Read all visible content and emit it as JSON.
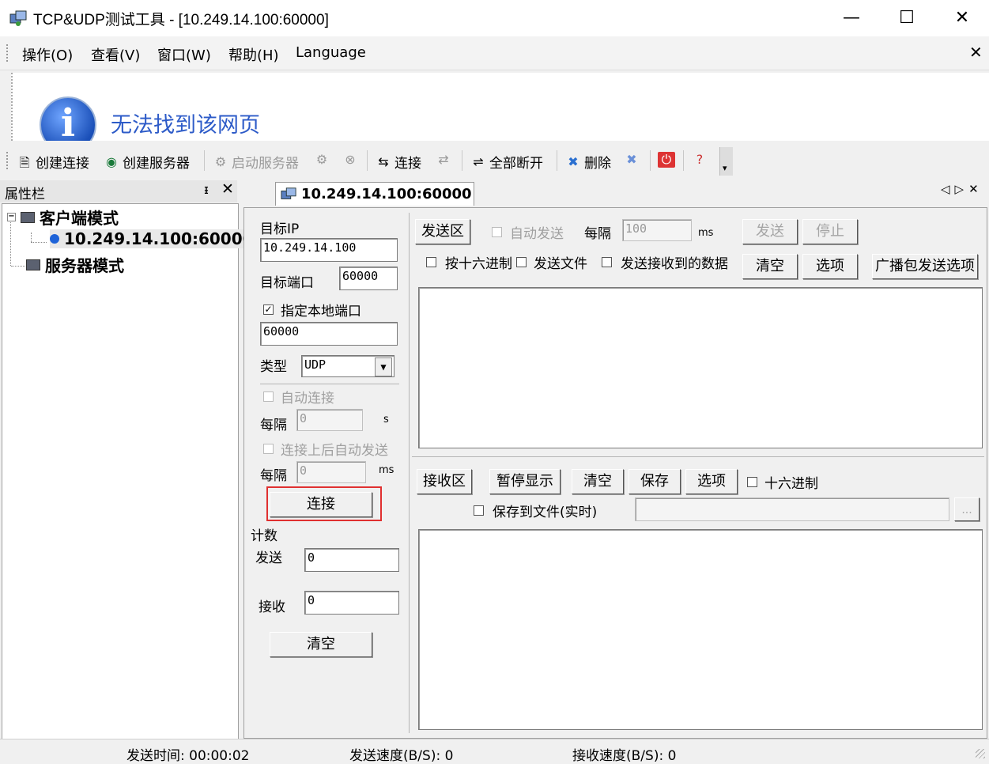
{
  "window": {
    "title": "TCP&UDP测试工具 - [10.249.14.100:60000]",
    "minimize_glyph": "—",
    "maximize_glyph": "☐",
    "close_glyph": "✕"
  },
  "menu": {
    "items": [
      "操作(O)",
      "查看(V)",
      "窗口(W)",
      "帮助(H)",
      "Language"
    ],
    "close_glyph": "✕"
  },
  "banner": {
    "icon_letter": "i",
    "text": "无法找到该网页"
  },
  "toolbar": {
    "create_connection": "创建连接",
    "create_server": "创建服务器",
    "start_server": "启动服务器",
    "connect": "连接",
    "disconnect_all": "全部断开",
    "delete": "删除"
  },
  "property_panel": {
    "title": "属性栏",
    "pin_glyph": "ᵻ",
    "close_glyph": "✕",
    "tree": {
      "client_mode": "客户端模式",
      "client_connection": "10.249.14.100:60000",
      "server_mode": "服务器模式"
    }
  },
  "tab": {
    "label": "10.249.14.100:60000",
    "nav_glyphs": "◁▷✕"
  },
  "connection": {
    "target_ip_label": "目标IP",
    "target_ip": "10.249.14.100",
    "target_port_label": "目标端口",
    "target_port": "60000",
    "local_port_checkbox": "指定本地端口",
    "local_port_checked": true,
    "local_port": "60000",
    "type_label": "类型",
    "type_value": "UDP",
    "auto_connect_label": "自动连接",
    "interval_label": "每隔",
    "auto_connect_interval": "0",
    "auto_connect_unit": "s",
    "auto_send_label": "连接上后自动发送",
    "auto_send_interval": "0",
    "auto_send_unit": "ms",
    "connect_button": "连接"
  },
  "counter": {
    "title": "计数",
    "send_label": "发送",
    "send_value": "0",
    "recv_label": "接收",
    "recv_value": "0",
    "clear_button": "清空"
  },
  "send_area": {
    "title": "发送区",
    "auto_send": "自动发送",
    "interval_label": "每隔",
    "interval": "100",
    "unit": "ms",
    "send_button": "发送",
    "stop_button": "停止",
    "hex_checkbox": "按十六进制",
    "send_file_checkbox": "发送文件",
    "send_received_checkbox": "发送接收到的数据",
    "clear_button": "清空",
    "options_button": "选项",
    "broadcast_button": "广播包发送选项"
  },
  "recv_area": {
    "title": "接收区",
    "pause_button": "暂停显示",
    "clear_button": "清空",
    "save_button": "保存",
    "options_button": "选项",
    "hex_checkbox": "十六进制",
    "save_to_file_checkbox": "保存到文件(实时)",
    "browse_button": "..."
  },
  "statusbar": {
    "send_time": "发送时间: 00:00:02",
    "send_speed": "发送速度(B/S): 0",
    "recv_speed": "接收速度(B/S): 0"
  },
  "colors": {
    "highlight_border": "#e03030",
    "banner_text": "#2d5bc8"
  }
}
